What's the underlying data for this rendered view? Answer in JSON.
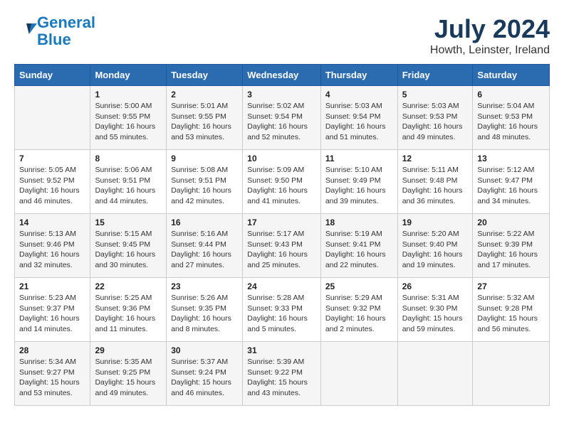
{
  "header": {
    "logo_line1": "General",
    "logo_line2": "Blue",
    "month_title": "July 2024",
    "location": "Howth, Leinster, Ireland"
  },
  "columns": [
    "Sunday",
    "Monday",
    "Tuesday",
    "Wednesday",
    "Thursday",
    "Friday",
    "Saturday"
  ],
  "weeks": [
    [
      {
        "day": "",
        "info": ""
      },
      {
        "day": "1",
        "info": "Sunrise: 5:00 AM\nSunset: 9:55 PM\nDaylight: 16 hours\nand 55 minutes."
      },
      {
        "day": "2",
        "info": "Sunrise: 5:01 AM\nSunset: 9:55 PM\nDaylight: 16 hours\nand 53 minutes."
      },
      {
        "day": "3",
        "info": "Sunrise: 5:02 AM\nSunset: 9:54 PM\nDaylight: 16 hours\nand 52 minutes."
      },
      {
        "day": "4",
        "info": "Sunrise: 5:03 AM\nSunset: 9:54 PM\nDaylight: 16 hours\nand 51 minutes."
      },
      {
        "day": "5",
        "info": "Sunrise: 5:03 AM\nSunset: 9:53 PM\nDaylight: 16 hours\nand 49 minutes."
      },
      {
        "day": "6",
        "info": "Sunrise: 5:04 AM\nSunset: 9:53 PM\nDaylight: 16 hours\nand 48 minutes."
      }
    ],
    [
      {
        "day": "7",
        "info": "Sunrise: 5:05 AM\nSunset: 9:52 PM\nDaylight: 16 hours\nand 46 minutes."
      },
      {
        "day": "8",
        "info": "Sunrise: 5:06 AM\nSunset: 9:51 PM\nDaylight: 16 hours\nand 44 minutes."
      },
      {
        "day": "9",
        "info": "Sunrise: 5:08 AM\nSunset: 9:51 PM\nDaylight: 16 hours\nand 42 minutes."
      },
      {
        "day": "10",
        "info": "Sunrise: 5:09 AM\nSunset: 9:50 PM\nDaylight: 16 hours\nand 41 minutes."
      },
      {
        "day": "11",
        "info": "Sunrise: 5:10 AM\nSunset: 9:49 PM\nDaylight: 16 hours\nand 39 minutes."
      },
      {
        "day": "12",
        "info": "Sunrise: 5:11 AM\nSunset: 9:48 PM\nDaylight: 16 hours\nand 36 minutes."
      },
      {
        "day": "13",
        "info": "Sunrise: 5:12 AM\nSunset: 9:47 PM\nDaylight: 16 hours\nand 34 minutes."
      }
    ],
    [
      {
        "day": "14",
        "info": "Sunrise: 5:13 AM\nSunset: 9:46 PM\nDaylight: 16 hours\nand 32 minutes."
      },
      {
        "day": "15",
        "info": "Sunrise: 5:15 AM\nSunset: 9:45 PM\nDaylight: 16 hours\nand 30 minutes."
      },
      {
        "day": "16",
        "info": "Sunrise: 5:16 AM\nSunset: 9:44 PM\nDaylight: 16 hours\nand 27 minutes."
      },
      {
        "day": "17",
        "info": "Sunrise: 5:17 AM\nSunset: 9:43 PM\nDaylight: 16 hours\nand 25 minutes."
      },
      {
        "day": "18",
        "info": "Sunrise: 5:19 AM\nSunset: 9:41 PM\nDaylight: 16 hours\nand 22 minutes."
      },
      {
        "day": "19",
        "info": "Sunrise: 5:20 AM\nSunset: 9:40 PM\nDaylight: 16 hours\nand 19 minutes."
      },
      {
        "day": "20",
        "info": "Sunrise: 5:22 AM\nSunset: 9:39 PM\nDaylight: 16 hours\nand 17 minutes."
      }
    ],
    [
      {
        "day": "21",
        "info": "Sunrise: 5:23 AM\nSunset: 9:37 PM\nDaylight: 16 hours\nand 14 minutes."
      },
      {
        "day": "22",
        "info": "Sunrise: 5:25 AM\nSunset: 9:36 PM\nDaylight: 16 hours\nand 11 minutes."
      },
      {
        "day": "23",
        "info": "Sunrise: 5:26 AM\nSunset: 9:35 PM\nDaylight: 16 hours\nand 8 minutes."
      },
      {
        "day": "24",
        "info": "Sunrise: 5:28 AM\nSunset: 9:33 PM\nDaylight: 16 hours\nand 5 minutes."
      },
      {
        "day": "25",
        "info": "Sunrise: 5:29 AM\nSunset: 9:32 PM\nDaylight: 16 hours\nand 2 minutes."
      },
      {
        "day": "26",
        "info": "Sunrise: 5:31 AM\nSunset: 9:30 PM\nDaylight: 15 hours\nand 59 minutes."
      },
      {
        "day": "27",
        "info": "Sunrise: 5:32 AM\nSunset: 9:28 PM\nDaylight: 15 hours\nand 56 minutes."
      }
    ],
    [
      {
        "day": "28",
        "info": "Sunrise: 5:34 AM\nSunset: 9:27 PM\nDaylight: 15 hours\nand 53 minutes."
      },
      {
        "day": "29",
        "info": "Sunrise: 5:35 AM\nSunset: 9:25 PM\nDaylight: 15 hours\nand 49 minutes."
      },
      {
        "day": "30",
        "info": "Sunrise: 5:37 AM\nSunset: 9:24 PM\nDaylight: 15 hours\nand 46 minutes."
      },
      {
        "day": "31",
        "info": "Sunrise: 5:39 AM\nSunset: 9:22 PM\nDaylight: 15 hours\nand 43 minutes."
      },
      {
        "day": "",
        "info": ""
      },
      {
        "day": "",
        "info": ""
      },
      {
        "day": "",
        "info": ""
      }
    ]
  ]
}
